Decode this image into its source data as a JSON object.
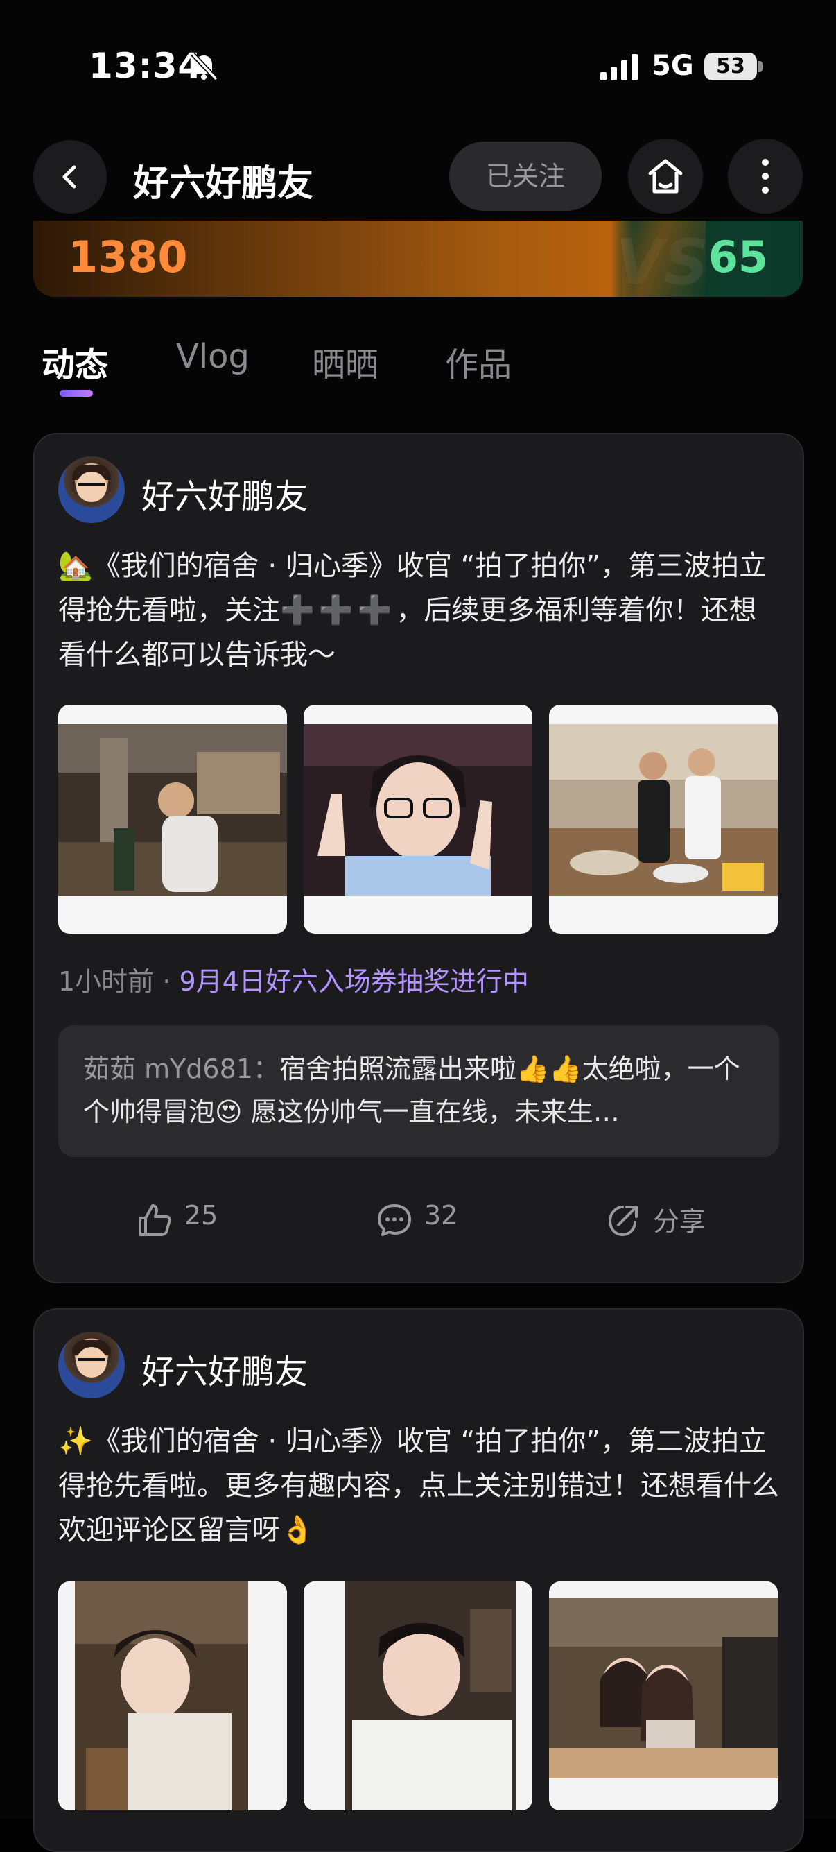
{
  "status_bar": {
    "time": "13:34",
    "network": "5G",
    "battery": "53",
    "icons": [
      "bell-slash-icon",
      "signal-icon",
      "battery-icon"
    ]
  },
  "header": {
    "title": "好六好鹏友",
    "follow_label": "已关注",
    "icons": [
      "back-icon",
      "home-icon",
      "more-icon"
    ]
  },
  "versus": {
    "left_score": "1380",
    "right_score": "65",
    "mark": "VS",
    "left_color": "#ff8a3a",
    "right_color": "#5de39c"
  },
  "tabs": [
    {
      "label": "动态",
      "active": true
    },
    {
      "label": "Vlog",
      "active": false
    },
    {
      "label": "晒晒",
      "active": false
    },
    {
      "label": "作品",
      "active": false
    }
  ],
  "posts": [
    {
      "author": "好六好鹏友",
      "emoji": "🏡",
      "text_before": "《我们的宿舍 · 归心季》收官 “拍了拍你”，第三波拍立得抢先看啦，关注",
      "plus_text": "➕➕➕",
      "text_after": "，后续更多福利等着你！还想看什么都可以告诉我～",
      "time": "1小时前",
      "dot": "·",
      "event_link": "9月4日好六入场券抽奖进行中",
      "comment": {
        "user": "茹茹 mYd681：",
        "text": "宿舍拍照流露出来啦👍👍太绝啦，一个个帅得冒泡😍 愿这份帅气一直在线，未来生…"
      },
      "likes": "25",
      "comments": "32",
      "share_label": "分享"
    },
    {
      "author": "好六好鹏友",
      "emoji": "✨",
      "text": "《我们的宿舍 · 归心季》收官 “拍了拍你”，第二波拍立得抢先看啦。更多有趣内容，点上关注别错过！还想看什么欢迎评论区留言呀👌"
    }
  ],
  "colors": {
    "background": "#050505",
    "card": "#1b1b1d",
    "accent_purple": "#b393ff"
  }
}
